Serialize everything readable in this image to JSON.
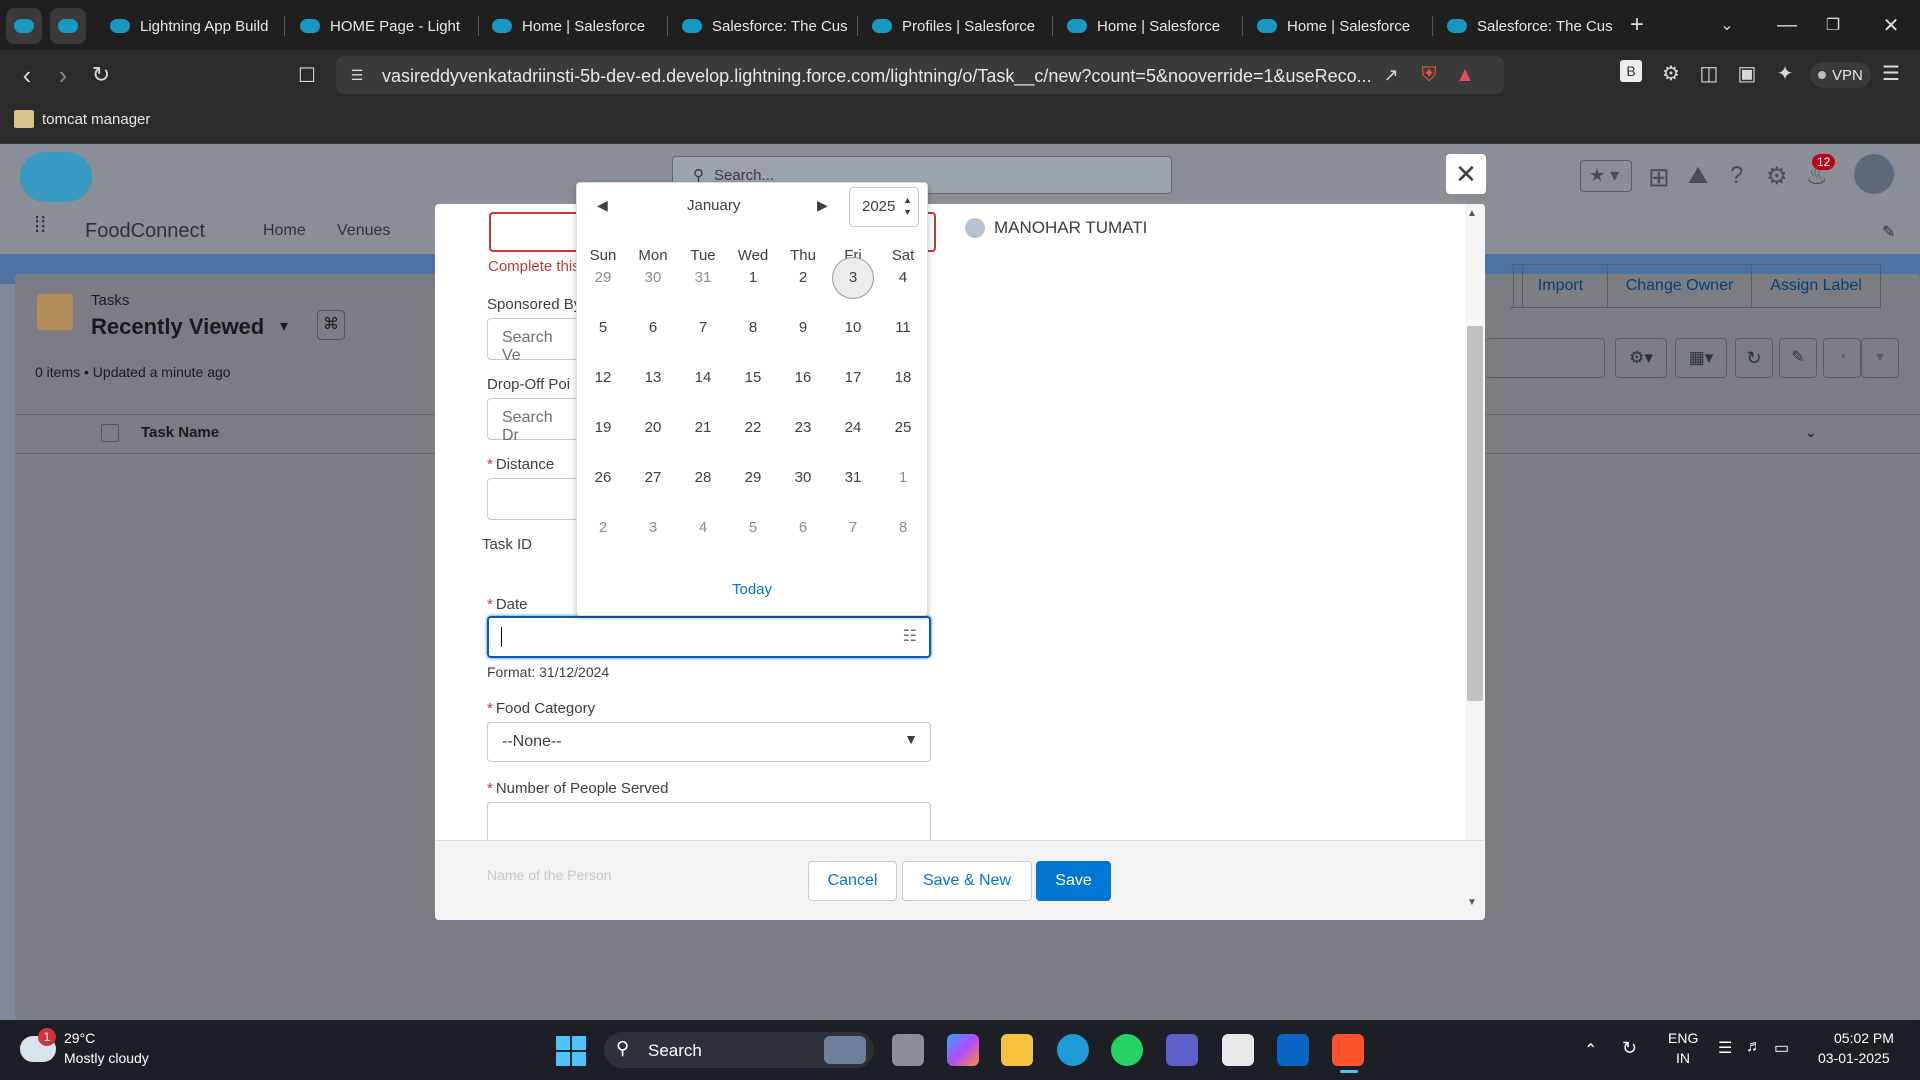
{
  "browser": {
    "tabs": [
      {
        "label": "Lightning App Build"
      },
      {
        "label": "HOME Page - Light"
      },
      {
        "label": "Home | Salesforce"
      },
      {
        "label": "Salesforce: The Cus"
      },
      {
        "label": "Profiles | Salesforce"
      },
      {
        "label": "Home | Salesforce"
      },
      {
        "label": "Home | Salesforce"
      },
      {
        "label": "Salesforce: The Cus"
      }
    ],
    "url": "vasireddyvenkatadriinsti-5b-dev-ed.develop.lightning.force.com/lightning/o/Task__c/new?count=5&nooverride=1&useReco...",
    "vpn_label": "VPN",
    "bookmark": "tomcat manager"
  },
  "sf": {
    "search_placeholder": "Search...",
    "app_name": "FoodConnect",
    "nav": [
      "Home",
      "Venues"
    ],
    "notification_count": "12",
    "list": {
      "object": "Tasks",
      "view": "Recently Viewed",
      "status": "0 items • Updated a minute ago",
      "column": "Task Name",
      "actions": [
        "Import",
        "Change Owner",
        "Assign Label"
      ]
    }
  },
  "form": {
    "complete_msg": "Complete this",
    "sponsored_label": "Sponsored By",
    "sponsored_placeholder": "Search Ve",
    "dropoff_label": "Drop-Off Poi",
    "dropoff_placeholder": "Search Dr",
    "distance_label": "Distance",
    "taskid_label": "Task ID",
    "date_label": "Date",
    "date_format": "Format: 31/12/2024",
    "food_label": "Food Category",
    "food_value": "--None--",
    "people_label": "Number of People Served",
    "person_label": "Name of the Person",
    "owner_name": "MANOHAR TUMATI",
    "required_mark": "*",
    "cancel": "Cancel",
    "save_new": "Save & New",
    "save": "Save"
  },
  "picker": {
    "month": "January",
    "year": "2025",
    "weekdays": [
      "Sun",
      "Mon",
      "Tue",
      "Wed",
      "Thu",
      "Fri",
      "Sat"
    ],
    "days": [
      [
        "29",
        "30",
        "31",
        "1",
        "2",
        "3",
        "4"
      ],
      [
        "5",
        "6",
        "7",
        "8",
        "9",
        "10",
        "11"
      ],
      [
        "12",
        "13",
        "14",
        "15",
        "16",
        "17",
        "18"
      ],
      [
        "19",
        "20",
        "21",
        "22",
        "23",
        "24",
        "25"
      ],
      [
        "26",
        "27",
        "28",
        "29",
        "30",
        "31",
        "1"
      ],
      [
        "2",
        "3",
        "4",
        "5",
        "6",
        "7",
        "8"
      ]
    ],
    "today_label": "Today"
  },
  "taskbar": {
    "weather_temp": "29°C",
    "weather_desc": "Mostly cloudy",
    "weather_badge": "1",
    "search": "Search",
    "lang1": "ENG",
    "lang2": "IN",
    "time": "05:02 PM",
    "date": "03-01-2025"
  }
}
